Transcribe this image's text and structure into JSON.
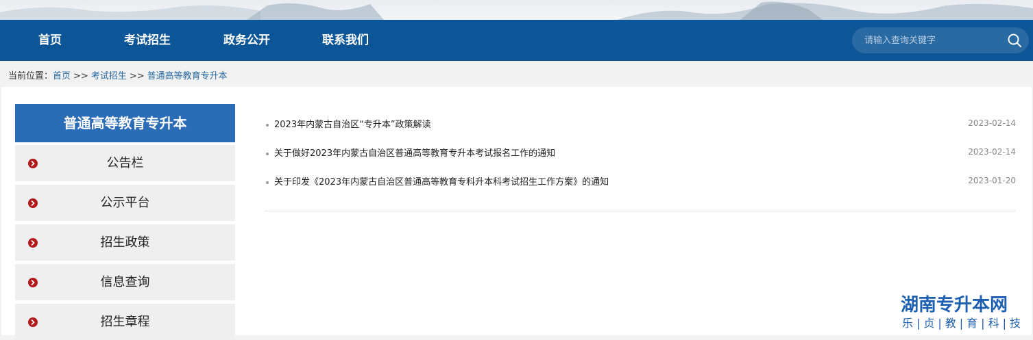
{
  "nav": {
    "items": [
      {
        "label": "首页"
      },
      {
        "label": "考试招生"
      },
      {
        "label": "政务公开"
      },
      {
        "label": "联系我们"
      }
    ],
    "search_placeholder": "请输入查询关键字",
    "color": "#0c5596"
  },
  "breadcrumb": {
    "prefix": "当前位置：",
    "items": [
      "首页",
      "考试招生",
      "普通高等教育专升本"
    ],
    "separator": ">>"
  },
  "sidebar": {
    "title": "普通高等教育专升本",
    "title_color": "#2a6cb5",
    "items": [
      {
        "label": "公告栏"
      },
      {
        "label": "公示平台"
      },
      {
        "label": "招生政策"
      },
      {
        "label": "信息查询"
      },
      {
        "label": "招生章程"
      }
    ]
  },
  "articles": [
    {
      "title": "2023年内蒙古自治区“专升本”政策解读",
      "date": "2023-02-14"
    },
    {
      "title": "关于做好2023年内蒙古自治区普通高等教育专升本考试报名工作的通知",
      "date": "2023-02-14"
    },
    {
      "title": "关于印发《2023年内蒙古自治区普通高等教育专科升本科考试招生工作方案》的通知",
      "date": "2023-01-20"
    }
  ],
  "watermark": {
    "title": "湖南专升本网",
    "subtitle": "乐|贞|教|育|科|技"
  }
}
